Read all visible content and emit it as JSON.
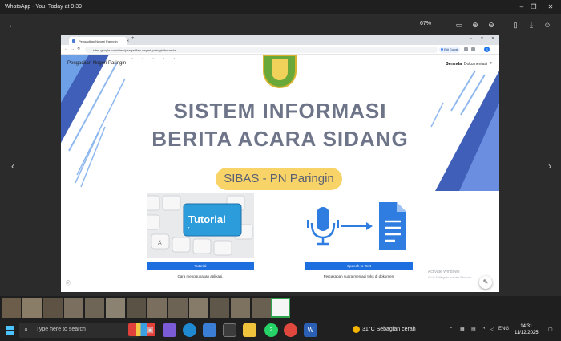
{
  "window": {
    "title": "WhatsApp - You, Today at 9:39"
  },
  "viewer": {
    "zoom": "67%"
  },
  "browser": {
    "tab_title": "Pengadilan Negeri Paringin",
    "url": "sites.google.com/view/pengadilan-negeri-paringin/beranda",
    "google_button": "Edit Google",
    "avatar_letter": "S"
  },
  "site": {
    "name": "Pengadilan Negeri Paringin",
    "nav": [
      "Beranda",
      "Dokumentasi"
    ],
    "hero_line1": "SISTEM INFORMASI",
    "hero_line2": "BERITA ACARA SIDANG",
    "pill": "SIBAS - PN Paringin",
    "cards": [
      {
        "image_text": "Tutorial",
        "button": "Tutorial",
        "caption": "Cara menggunakan aplikasi."
      },
      {
        "button": "Speech to Text",
        "caption": "Percakapan suara menjadi teks di dokumen."
      }
    ],
    "activate_title": "Activate Windows",
    "activate_sub": "Go to Settings to activate Windows."
  },
  "taskbar": {
    "search_placeholder": "Type here to search",
    "weather": "31°C  Sebagian cerah",
    "lang": "ENG",
    "time": "14:31",
    "date": "11/12/2025",
    "whatsapp_badge": "2"
  },
  "colors": {
    "accent_blue": "#1d6fe0",
    "pill_yellow": "#f7d368",
    "hero_text": "#6e7589"
  }
}
